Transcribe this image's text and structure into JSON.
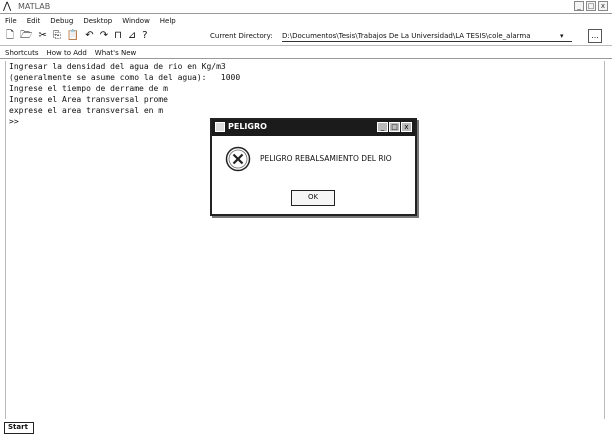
{
  "window": {
    "app_icon": "matlab-logo-icon",
    "title": "MATLAB",
    "controls": [
      "_",
      "□",
      "x"
    ]
  },
  "menubar": {
    "items": [
      "File",
      "Edit",
      "Debug",
      "Desktop",
      "Window",
      "Help"
    ]
  },
  "toolbar": {
    "icons": [
      "new-file-icon",
      "open-file-icon",
      "cut-icon",
      "copy-icon",
      "paste-icon",
      "undo-icon",
      "redo-icon",
      "simulink-icon",
      "guide-icon",
      "help-icon"
    ],
    "current_directory_label": "Current Directory:",
    "current_directory_value": "D:\\Documentos\\Tesis\\Trabajos De La Universidad\\LA TESIS\\cole_alarma",
    "browse_label": "..."
  },
  "shortcuts": {
    "items": [
      "Shortcuts",
      "How to Add",
      "What's New"
    ]
  },
  "console": {
    "lines": [
      "Ingresar la densidad del agua de rio en Kg/m3",
      "(generalmente se asume como la del agua):   1000",
      "Ingrese el tiempo de derrame de m",
      "Ingrese el Area transversal prome",
      "exprese el area transversal en m",
      ">>"
    ]
  },
  "dialog": {
    "title": "PELIGRO",
    "title_controls": [
      "_",
      "□",
      "x"
    ],
    "message": "PELIGRO REBALSAMIENTO DEL RIO",
    "ok_label": "OK"
  },
  "startbar": {
    "start_label": "Start"
  },
  "colors": {
    "dialog_titlebar": "#1b1b1b",
    "background": "#ffffff"
  }
}
